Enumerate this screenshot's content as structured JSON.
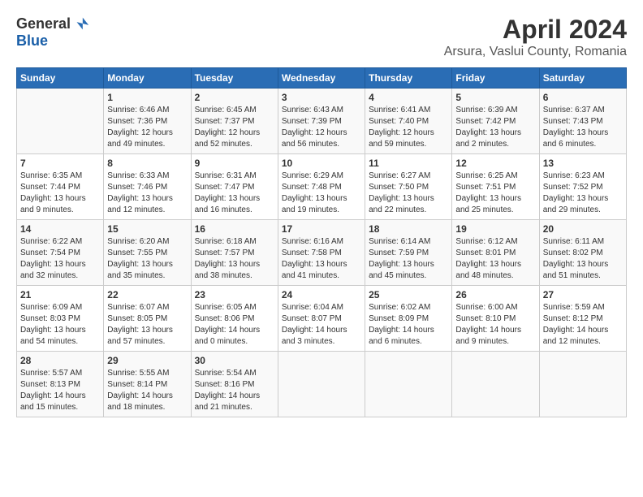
{
  "header": {
    "logo_general": "General",
    "logo_blue": "Blue",
    "title": "April 2024",
    "subtitle": "Arsura, Vaslui County, Romania"
  },
  "days_of_week": [
    "Sunday",
    "Monday",
    "Tuesday",
    "Wednesday",
    "Thursday",
    "Friday",
    "Saturday"
  ],
  "weeks": [
    [
      {
        "day": "",
        "detail": ""
      },
      {
        "day": "1",
        "detail": "Sunrise: 6:46 AM\nSunset: 7:36 PM\nDaylight: 12 hours\nand 49 minutes."
      },
      {
        "day": "2",
        "detail": "Sunrise: 6:45 AM\nSunset: 7:37 PM\nDaylight: 12 hours\nand 52 minutes."
      },
      {
        "day": "3",
        "detail": "Sunrise: 6:43 AM\nSunset: 7:39 PM\nDaylight: 12 hours\nand 56 minutes."
      },
      {
        "day": "4",
        "detail": "Sunrise: 6:41 AM\nSunset: 7:40 PM\nDaylight: 12 hours\nand 59 minutes."
      },
      {
        "day": "5",
        "detail": "Sunrise: 6:39 AM\nSunset: 7:42 PM\nDaylight: 13 hours\nand 2 minutes."
      },
      {
        "day": "6",
        "detail": "Sunrise: 6:37 AM\nSunset: 7:43 PM\nDaylight: 13 hours\nand 6 minutes."
      }
    ],
    [
      {
        "day": "7",
        "detail": "Sunrise: 6:35 AM\nSunset: 7:44 PM\nDaylight: 13 hours\nand 9 minutes."
      },
      {
        "day": "8",
        "detail": "Sunrise: 6:33 AM\nSunset: 7:46 PM\nDaylight: 13 hours\nand 12 minutes."
      },
      {
        "day": "9",
        "detail": "Sunrise: 6:31 AM\nSunset: 7:47 PM\nDaylight: 13 hours\nand 16 minutes."
      },
      {
        "day": "10",
        "detail": "Sunrise: 6:29 AM\nSunset: 7:48 PM\nDaylight: 13 hours\nand 19 minutes."
      },
      {
        "day": "11",
        "detail": "Sunrise: 6:27 AM\nSunset: 7:50 PM\nDaylight: 13 hours\nand 22 minutes."
      },
      {
        "day": "12",
        "detail": "Sunrise: 6:25 AM\nSunset: 7:51 PM\nDaylight: 13 hours\nand 25 minutes."
      },
      {
        "day": "13",
        "detail": "Sunrise: 6:23 AM\nSunset: 7:52 PM\nDaylight: 13 hours\nand 29 minutes."
      }
    ],
    [
      {
        "day": "14",
        "detail": "Sunrise: 6:22 AM\nSunset: 7:54 PM\nDaylight: 13 hours\nand 32 minutes."
      },
      {
        "day": "15",
        "detail": "Sunrise: 6:20 AM\nSunset: 7:55 PM\nDaylight: 13 hours\nand 35 minutes."
      },
      {
        "day": "16",
        "detail": "Sunrise: 6:18 AM\nSunset: 7:57 PM\nDaylight: 13 hours\nand 38 minutes."
      },
      {
        "day": "17",
        "detail": "Sunrise: 6:16 AM\nSunset: 7:58 PM\nDaylight: 13 hours\nand 41 minutes."
      },
      {
        "day": "18",
        "detail": "Sunrise: 6:14 AM\nSunset: 7:59 PM\nDaylight: 13 hours\nand 45 minutes."
      },
      {
        "day": "19",
        "detail": "Sunrise: 6:12 AM\nSunset: 8:01 PM\nDaylight: 13 hours\nand 48 minutes."
      },
      {
        "day": "20",
        "detail": "Sunrise: 6:11 AM\nSunset: 8:02 PM\nDaylight: 13 hours\nand 51 minutes."
      }
    ],
    [
      {
        "day": "21",
        "detail": "Sunrise: 6:09 AM\nSunset: 8:03 PM\nDaylight: 13 hours\nand 54 minutes."
      },
      {
        "day": "22",
        "detail": "Sunrise: 6:07 AM\nSunset: 8:05 PM\nDaylight: 13 hours\nand 57 minutes."
      },
      {
        "day": "23",
        "detail": "Sunrise: 6:05 AM\nSunset: 8:06 PM\nDaylight: 14 hours\nand 0 minutes."
      },
      {
        "day": "24",
        "detail": "Sunrise: 6:04 AM\nSunset: 8:07 PM\nDaylight: 14 hours\nand 3 minutes."
      },
      {
        "day": "25",
        "detail": "Sunrise: 6:02 AM\nSunset: 8:09 PM\nDaylight: 14 hours\nand 6 minutes."
      },
      {
        "day": "26",
        "detail": "Sunrise: 6:00 AM\nSunset: 8:10 PM\nDaylight: 14 hours\nand 9 minutes."
      },
      {
        "day": "27",
        "detail": "Sunrise: 5:59 AM\nSunset: 8:12 PM\nDaylight: 14 hours\nand 12 minutes."
      }
    ],
    [
      {
        "day": "28",
        "detail": "Sunrise: 5:57 AM\nSunset: 8:13 PM\nDaylight: 14 hours\nand 15 minutes."
      },
      {
        "day": "29",
        "detail": "Sunrise: 5:55 AM\nSunset: 8:14 PM\nDaylight: 14 hours\nand 18 minutes."
      },
      {
        "day": "30",
        "detail": "Sunrise: 5:54 AM\nSunset: 8:16 PM\nDaylight: 14 hours\nand 21 minutes."
      },
      {
        "day": "",
        "detail": ""
      },
      {
        "day": "",
        "detail": ""
      },
      {
        "day": "",
        "detail": ""
      },
      {
        "day": "",
        "detail": ""
      }
    ]
  ]
}
